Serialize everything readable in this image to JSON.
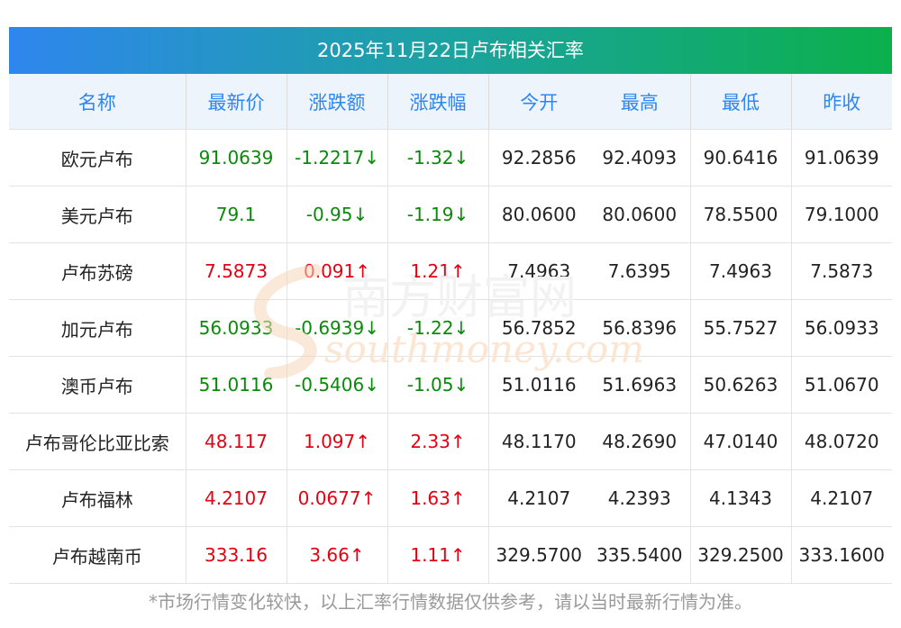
{
  "title": "2025年11月22日卢布相关汇率",
  "headers": [
    "名称",
    "最新价",
    "涨跌额",
    "涨跌幅",
    "今开",
    "最高",
    "最低",
    "昨收"
  ],
  "rows": [
    {
      "name": "欧元卢布",
      "latest": "91.0639",
      "change": "-1.2217↓",
      "pct": "-1.32↓",
      "open": "92.2856",
      "high": "92.4093",
      "low": "90.6416",
      "prev": "91.0639",
      "dir": "down"
    },
    {
      "name": "美元卢布",
      "latest": "79.1",
      "change": "-0.95↓",
      "pct": "-1.19↓",
      "open": "80.0600",
      "high": "80.0600",
      "low": "78.5500",
      "prev": "79.1000",
      "dir": "down"
    },
    {
      "name": "卢布苏磅",
      "latest": "7.5873",
      "change": "0.091↑",
      "pct": "1.21↑",
      "open": "7.4963",
      "high": "7.6395",
      "low": "7.4963",
      "prev": "7.5873",
      "dir": "up"
    },
    {
      "name": "加元卢布",
      "latest": "56.0933",
      "change": "-0.6939↓",
      "pct": "-1.22↓",
      "open": "56.7852",
      "high": "56.8396",
      "low": "55.7527",
      "prev": "56.0933",
      "dir": "down"
    },
    {
      "name": "澳币卢布",
      "latest": "51.0116",
      "change": "-0.5406↓",
      "pct": "-1.05↓",
      "open": "51.0116",
      "high": "51.6963",
      "low": "50.6263",
      "prev": "51.0670",
      "dir": "down"
    },
    {
      "name": "卢布哥伦比亚比索",
      "latest": "48.117",
      "change": "1.097↑",
      "pct": "2.33↑",
      "open": "48.1170",
      "high": "48.2690",
      "low": "47.0140",
      "prev": "48.0720",
      "dir": "up"
    },
    {
      "name": "卢布福林",
      "latest": "4.2107",
      "change": "0.0677↑",
      "pct": "1.63↑",
      "open": "4.2107",
      "high": "4.2393",
      "low": "4.1343",
      "prev": "4.2107",
      "dir": "up"
    },
    {
      "name": "卢布越南币",
      "latest": "333.16",
      "change": "3.66↑",
      "pct": "1.11↑",
      "open": "329.5700",
      "high": "335.5400",
      "low": "329.2500",
      "prev": "333.1600",
      "dir": "up"
    }
  ],
  "footnote": "*市场行情变化较快，以上汇率行情数据仅供参考，请以当时最新行情为准。",
  "watermark": {
    "cn": "南方财富网",
    "en": "southmoney.com"
  },
  "colors": {
    "up": "#e60012",
    "down": "#0a8a0a",
    "header_text": "#2f86ee"
  }
}
